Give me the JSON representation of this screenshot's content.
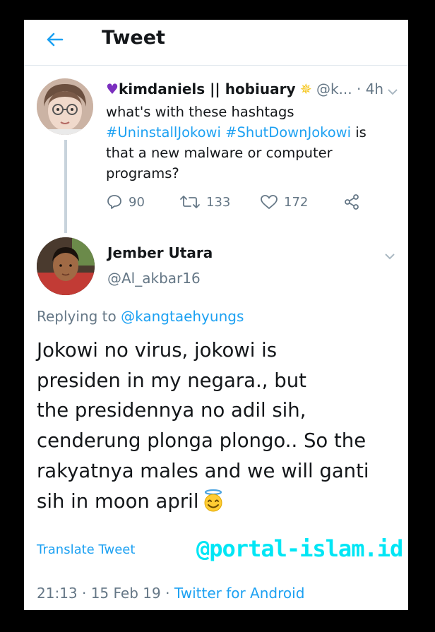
{
  "header": {
    "title": "Tweet"
  },
  "quoted_tweet": {
    "display_name": "kimdaniels || hobiuary",
    "handle": "@k...",
    "time": "· 4h",
    "text_before": "what's with these hashtags",
    "hashtag_1": "#UninstallJokowi",
    "hashtag_2": "#ShutDownJokowi",
    "text_after": "is that a new malware or computer programs?",
    "replies": "90",
    "retweets": "133",
    "likes": "172"
  },
  "reply_tweet": {
    "display_name": "Jember Utara",
    "handle": "@Al_akbar16",
    "replying_prefix": "Replying to ",
    "replying_to": "@kangtaehyungs",
    "text": "Jokowi no virus,  jokowi is\npresiden in my negara., but\nthe presidennya no adil sih,\ncenderung plonga plongo..  So the\nrakyatnya males and we will ganti\nsih in moon april",
    "translate_label": "Translate Tweet",
    "time": "21:13 · 15 Feb 19 · ",
    "source": "Twitter for Android"
  },
  "watermark": "@portal-islam.id",
  "colors": {
    "link": "#1da1f2",
    "muted": "#657786",
    "watermark": "#00e6f5"
  }
}
